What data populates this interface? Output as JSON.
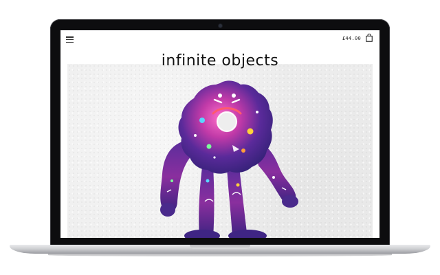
{
  "site": {
    "logo_text": "infinite objects",
    "cart_total": "£44.00"
  },
  "icons": {
    "menu": "hamburger-menu-icon",
    "cart": "shopping-bag-icon"
  },
  "hero": {
    "image_alt": "purple galaxy-print plush donut creature with long arms and legs"
  },
  "colors": {
    "background": "#ffffff",
    "bezel": "#0d0d0f",
    "hero_background": "#eeeeee",
    "plush_purple": "#6a2a8f",
    "plush_pink": "#e04fa8",
    "plush_blue": "#2a3a9a"
  }
}
